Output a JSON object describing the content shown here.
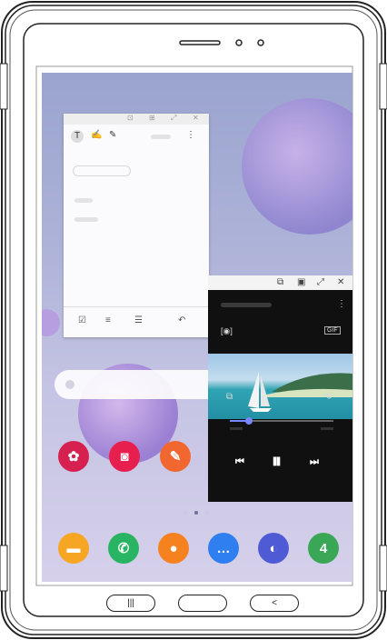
{
  "device": {
    "type": "tablet",
    "accent": "#222222"
  },
  "wallpaper": {
    "top": "#9aa4cf",
    "bottom": "#d6d0ea"
  },
  "notes_window": {
    "toolbar": {
      "text_tool": "T",
      "pen_tool": "✍",
      "brush_tool": "✎",
      "more": "⋮"
    },
    "title_bar_icons": [
      "⊡",
      "⊞",
      "⤢",
      "✕"
    ],
    "bottom_icons": [
      "☑",
      "≡",
      "☰",
      "↶"
    ]
  },
  "video_window": {
    "title_bar_icons": [
      "⧉",
      "▣",
      "⤢",
      "✕"
    ],
    "top_icons": {
      "capture": "[◉]",
      "gif": "GIF",
      "more": "⋮"
    },
    "mid_icons": {
      "pip": "⧉",
      "rotate": "⟲"
    },
    "progress": 0.18,
    "controls": {
      "prev": "⏮",
      "play_pause": "⏸",
      "next": "⏭"
    }
  },
  "home_apps": [
    {
      "name": "flower",
      "glyph": "✿",
      "color": "#d6204f"
    },
    {
      "name": "camera",
      "glyph": "◙",
      "color": "#e61f4f"
    },
    {
      "name": "notes",
      "glyph": "✎",
      "color": "#f2672f"
    }
  ],
  "dock_apps": [
    {
      "name": "folder",
      "glyph": "▬",
      "color": "#f6a623"
    },
    {
      "name": "phone",
      "glyph": "✆",
      "color": "#28b463"
    },
    {
      "name": "contacts",
      "glyph": "●",
      "color": "#f5811f"
    },
    {
      "name": "messages",
      "glyph": "…",
      "color": "#2f7ff0"
    },
    {
      "name": "internet",
      "glyph": "◐",
      "color": "#4f5bd5"
    },
    {
      "name": "calendar",
      "glyph": "4",
      "color": "#3aa757"
    }
  ],
  "page_indicator": {
    "count": 3,
    "active": 1
  },
  "nav": {
    "recents": "|||",
    "home": "",
    "back": "<"
  }
}
